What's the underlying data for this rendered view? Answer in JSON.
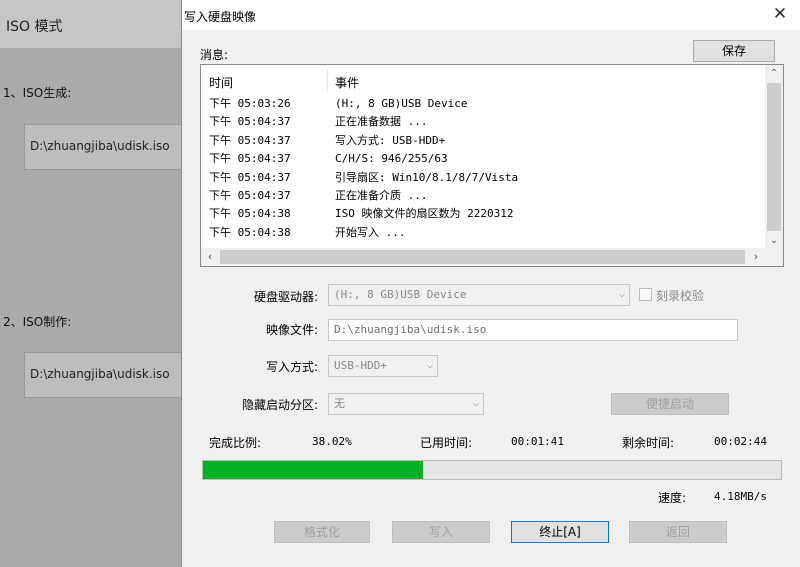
{
  "background": {
    "title": "ISO 模式",
    "section1_label": "1、ISO生成:",
    "section1_path": "D:\\zhuangjiba\\udisk.iso",
    "section2_label": "2、ISO制作:",
    "section2_path": "D:\\zhuangjiba\\udisk.iso"
  },
  "dialog": {
    "title": "写入硬盘映像",
    "close_icon": "close-icon",
    "message_label": "消息:",
    "save_label": "保存",
    "log": {
      "columns": [
        "时间",
        "事件"
      ],
      "rows": [
        {
          "time": "下午 05:03:26",
          "event": "(H:, 8 GB)USB Device"
        },
        {
          "time": "下午 05:04:37",
          "event": "正在准备数据 ..."
        },
        {
          "time": "下午 05:04:37",
          "event": "写入方式: USB-HDD+"
        },
        {
          "time": "下午 05:04:37",
          "event": "C/H/S: 946/255/63"
        },
        {
          "time": "下午 05:04:37",
          "event": "引导扇区: Win10/8.1/8/7/Vista"
        },
        {
          "time": "下午 05:04:37",
          "event": "正在准备介质 ..."
        },
        {
          "time": "下午 05:04:38",
          "event": "ISO 映像文件的扇区数为 2220312"
        },
        {
          "time": "下午 05:04:38",
          "event": "开始写入 ..."
        }
      ]
    },
    "drive_label": "硬盘驱动器:",
    "drive_value": "(H:, 8 GB)USB Device",
    "verify_label": "刻录校验",
    "verify_checked": false,
    "image_label": "映像文件:",
    "image_value": "D:\\zhuangjiba\\udisk.iso",
    "method_label": "写入方式:",
    "method_value": "USB-HDD+",
    "hidden_label": "隐藏启动分区:",
    "hidden_value": "无",
    "quick_boot_label": "便捷启动",
    "progress_label": "完成比例:",
    "progress_value": "38.02%",
    "progress_fraction": 0.3802,
    "elapsed_label": "已用时间:",
    "elapsed_value": "00:01:41",
    "remaining_label": "剩余时间:",
    "remaining_value": "00:02:44",
    "speed_label": "速度:",
    "speed_value": "4.18MB/s",
    "buttons": {
      "format": "格式化",
      "write": "写入",
      "stop": "终止[A]",
      "back": "返回"
    },
    "colors": {
      "progress_fill": "#06b025",
      "accent_border": "#0078d7"
    }
  }
}
